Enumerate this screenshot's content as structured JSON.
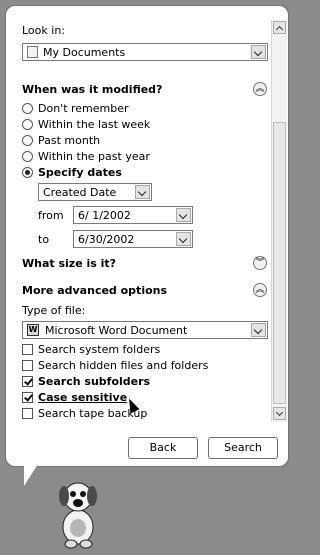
{
  "look_in": {
    "label": "Look in:",
    "value": "My Documents",
    "icon": "documents-folder-icon"
  },
  "modified": {
    "heading": "When was it modified?",
    "options": [
      {
        "label": "Don't remember",
        "selected": false
      },
      {
        "label": "Within the last week",
        "selected": false
      },
      {
        "label": "Past month",
        "selected": false
      },
      {
        "label": "Within the past year",
        "selected": false
      },
      {
        "label": "Specify dates",
        "selected": true
      }
    ],
    "date_type": "Created Date",
    "from_label": "from",
    "from_value": "6/  1/2002",
    "to_label": "to",
    "to_value": "6/30/2002",
    "collapse_icon": "collapse-up-icon"
  },
  "size": {
    "heading": "What size is it?",
    "expand_icon": "expand-down-icon"
  },
  "advanced": {
    "heading": "More advanced options",
    "collapse_icon": "collapse-up-icon",
    "type_label": "Type of file:",
    "type_value": "Microsoft Word Document",
    "checkboxes": [
      {
        "label": "Search system folders",
        "checked": false,
        "bold": false
      },
      {
        "label": "Search hidden files and folders",
        "checked": false,
        "bold": false
      },
      {
        "label": "Search subfolders",
        "checked": true,
        "bold": true
      },
      {
        "label": "Case sensitive",
        "checked": true,
        "bold": true
      },
      {
        "label": "Search tape backup",
        "checked": false,
        "bold": false
      }
    ]
  },
  "buttons": {
    "back": "Back",
    "search": "Search"
  },
  "assistant_icon": "search-companion-dog-icon",
  "colors": {
    "background": "#8b8b8b",
    "panel": "#ffffff"
  }
}
